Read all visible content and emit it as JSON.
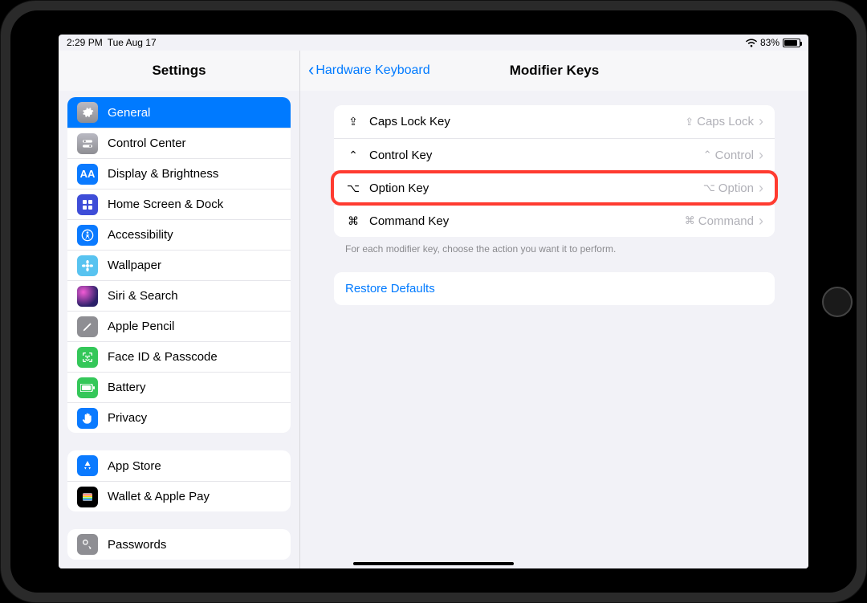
{
  "status": {
    "time": "2:29 PM",
    "date": "Tue Aug 17",
    "battery_pct": "83%"
  },
  "sidebar": {
    "title": "Settings",
    "group1": [
      {
        "label": "General"
      },
      {
        "label": "Control Center"
      },
      {
        "label": "Display & Brightness"
      },
      {
        "label": "Home Screen & Dock"
      },
      {
        "label": "Accessibility"
      },
      {
        "label": "Wallpaper"
      },
      {
        "label": "Siri & Search"
      },
      {
        "label": "Apple Pencil"
      },
      {
        "label": "Face ID & Passcode"
      },
      {
        "label": "Battery"
      },
      {
        "label": "Privacy"
      }
    ],
    "group2": [
      {
        "label": "App Store"
      },
      {
        "label": "Wallet & Apple Pay"
      }
    ],
    "group3": [
      {
        "label": "Passwords"
      }
    ]
  },
  "detail": {
    "back_label": "Hardware Keyboard",
    "title": "Modifier Keys",
    "rows": [
      {
        "sym": "⇪",
        "label": "Caps Lock Key",
        "vsym": "⇪",
        "value": "Caps Lock"
      },
      {
        "sym": "⌃",
        "label": "Control Key",
        "vsym": "⌃",
        "value": "Control"
      },
      {
        "sym": "⌥",
        "label": "Option Key",
        "vsym": "⌥",
        "value": "Option"
      },
      {
        "sym": "⌘",
        "label": "Command Key",
        "vsym": "⌘",
        "value": "Command"
      }
    ],
    "footnote": "For each modifier key, choose the action you want it to perform.",
    "restore": "Restore Defaults"
  }
}
